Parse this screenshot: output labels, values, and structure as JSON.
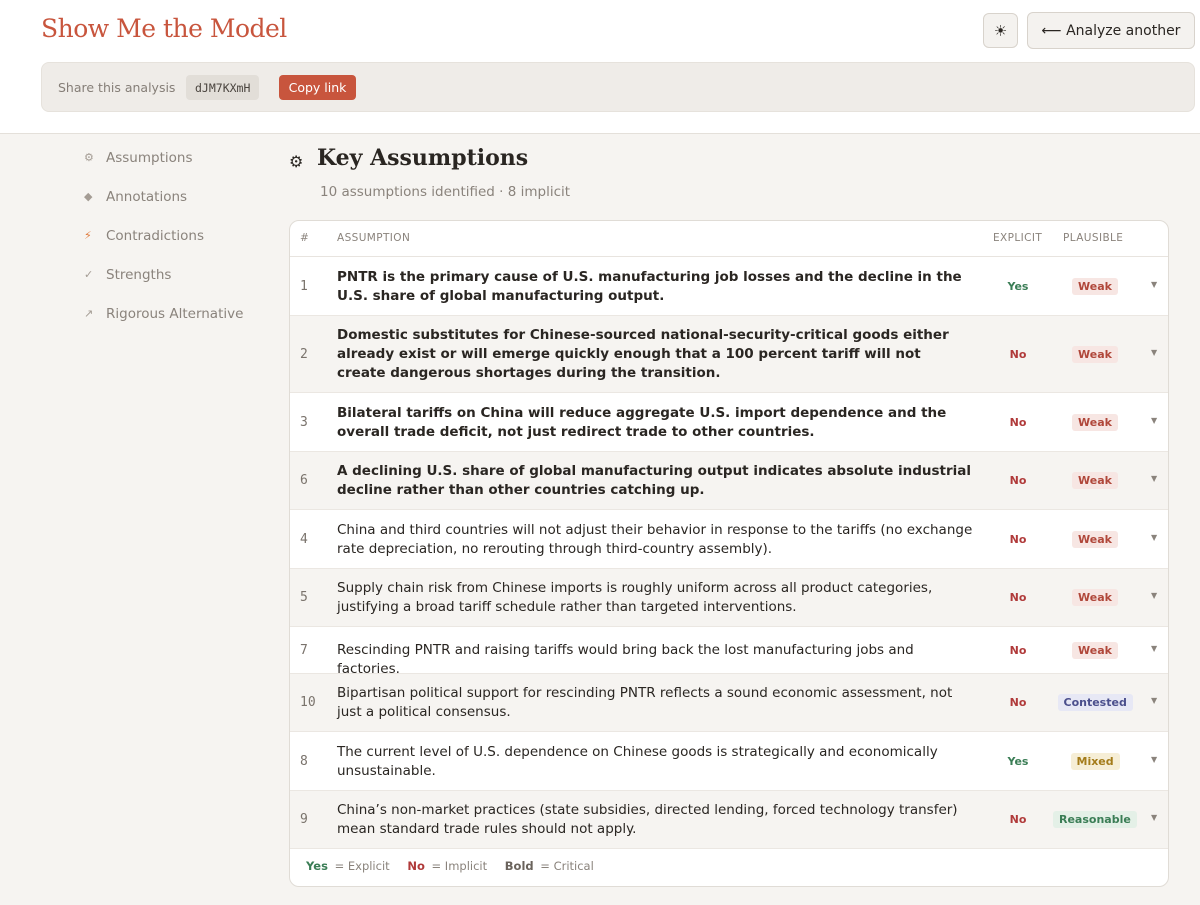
{
  "header": {
    "brand": "Show Me the Model",
    "theme_icon": "sun-icon",
    "theme_glyph": "☀",
    "analyze_label": "⟵ Analyze another"
  },
  "share": {
    "label": "Share this analysis",
    "code": "dJM7KXmH",
    "copy_label": "Copy link"
  },
  "sidebar": {
    "items": [
      {
        "label": "Assumptions",
        "icon": "gear-icon",
        "glyph": "⚙"
      },
      {
        "label": "Annotations",
        "icon": "diamond-icon",
        "glyph": "◆"
      },
      {
        "label": "Contradictions",
        "icon": "lightning-icon",
        "glyph": "⚡"
      },
      {
        "label": "Strengths",
        "icon": "check-icon",
        "glyph": "✓"
      },
      {
        "label": "Rigorous Alternative",
        "icon": "arrow-icon",
        "glyph": "↗"
      }
    ]
  },
  "section": {
    "icon_glyph": "⚙",
    "title": "Key Assumptions",
    "subtitle": "10 assumptions identified · 8 implicit"
  },
  "table": {
    "headers": {
      "num": "#",
      "assumption": "ASSUMPTION",
      "explicit": "EXPLICIT",
      "plausible": "PLAUSIBLE"
    },
    "rows": [
      {
        "num": "1",
        "text": "PNTR is the primary cause of U.S. manufacturing job losses and the decline in the U.S. share of global manufacturing output.",
        "bold": true,
        "explicit": "Yes",
        "plausible": "Weak"
      },
      {
        "num": "2",
        "text": "Domestic substitutes for Chinese-sourced national-security-critical goods either already exist or will emerge quickly enough that a 100 percent tariff will not create dangerous shortages during the transition.",
        "bold": true,
        "explicit": "No",
        "plausible": "Weak"
      },
      {
        "num": "3",
        "text": "Bilateral tariffs on China will reduce aggregate U.S. import dependence and the overall trade deficit, not just redirect trade to other countries.",
        "bold": true,
        "explicit": "No",
        "plausible": "Weak"
      },
      {
        "num": "6",
        "text": "A declining U.S. share of global manufacturing output indicates absolute industrial decline rather than other countries catching up.",
        "bold": true,
        "explicit": "No",
        "plausible": "Weak"
      },
      {
        "num": "4",
        "text": "China and third countries will not adjust their behavior in response to the tariffs (no exchange rate depreciation, no rerouting through third-country assembly).",
        "bold": false,
        "explicit": "No",
        "plausible": "Weak"
      },
      {
        "num": "5",
        "text": "Supply chain risk from Chinese imports is roughly uniform across all product categories, justifying a broad tariff schedule rather than targeted interventions.",
        "bold": false,
        "explicit": "No",
        "plausible": "Weak"
      },
      {
        "num": "7",
        "text": "Rescinding PNTR and raising tariffs would bring back the lost manufacturing jobs and factories.",
        "bold": false,
        "explicit": "No",
        "plausible": "Weak"
      },
      {
        "num": "10",
        "text": "Bipartisan political support for rescinding PNTR reflects a sound economic assessment, not just a political consensus.",
        "bold": false,
        "explicit": "No",
        "plausible": "Contested"
      },
      {
        "num": "8",
        "text": "The current level of U.S. dependence on Chinese goods is strategically and economically unsustainable.",
        "bold": false,
        "explicit": "Yes",
        "plausible": "Mixed"
      },
      {
        "num": "9",
        "text": "China’s non-market practices (state subsidies, directed lending, forced technology transfer) mean standard trade rules should not apply.",
        "bold": false,
        "explicit": "No",
        "plausible": "Reasonable"
      }
    ],
    "caret_glyph": "▼",
    "legend": {
      "yes_key": "Yes",
      "yes_desc": "= Explicit",
      "no_key": "No",
      "no_desc": "= Implicit",
      "bold_key": "Bold",
      "bold_desc": "= Critical"
    }
  }
}
